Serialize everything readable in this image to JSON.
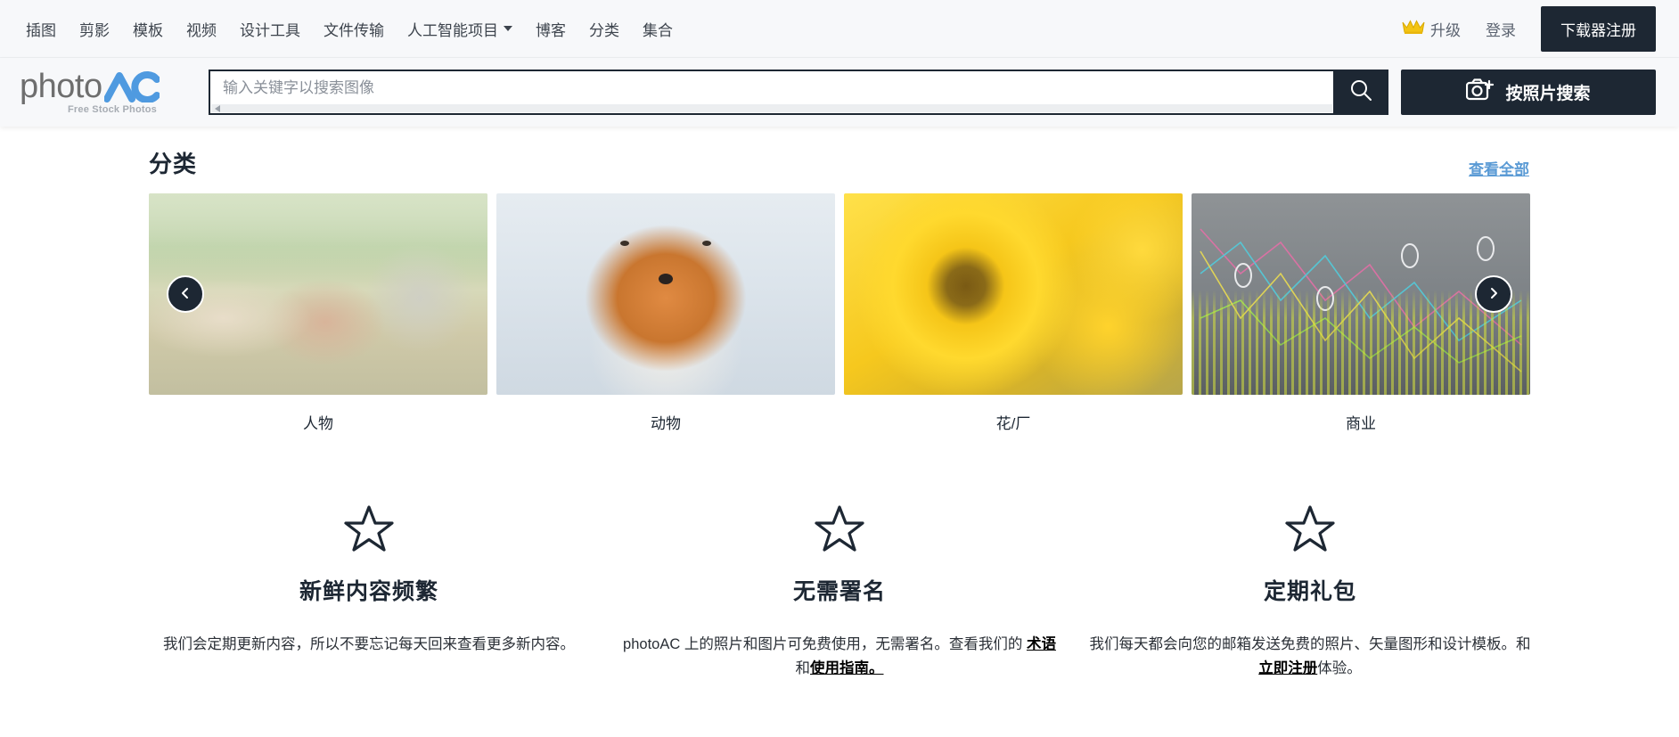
{
  "topnav": {
    "items": [
      {
        "label": "插图",
        "has_caret": false
      },
      {
        "label": "剪影",
        "has_caret": false
      },
      {
        "label": "模板",
        "has_caret": false
      },
      {
        "label": "视频",
        "has_caret": false
      },
      {
        "label": "设计工具",
        "has_caret": false
      },
      {
        "label": "文件传输",
        "has_caret": false
      },
      {
        "label": "人工智能项目",
        "has_caret": true
      },
      {
        "label": "博客",
        "has_caret": false
      },
      {
        "label": "分类",
        "has_caret": false
      },
      {
        "label": "集合",
        "has_caret": false
      }
    ],
    "upgrade_label": "升级",
    "login_label": "登录",
    "register_label": "下载器注册",
    "crown_icon": "crown-icon"
  },
  "search": {
    "logo_text_1": "photo",
    "logo_text_2": "AC",
    "logo_tagline": "Free Stock Photos",
    "placeholder": "输入关键字以搜索图像",
    "value": "",
    "search_icon": "search-icon",
    "photo_search_label": "按照片搜索",
    "camera_icon": "camera-plus-icon"
  },
  "categories": {
    "title": "分类",
    "view_all": "查看全部",
    "prev_icon": "chevron-left-icon",
    "next_icon": "chevron-right-icon",
    "items": [
      {
        "label": "人物",
        "art": "t-people"
      },
      {
        "label": "动物",
        "art": "t-fox"
      },
      {
        "label": "花/厂",
        "art": "t-flower"
      },
      {
        "label": "商业",
        "art": "t-biz"
      }
    ]
  },
  "features": [
    {
      "icon": "star-icon",
      "title": "新鲜内容频繁",
      "desc_prefix": "我们会定期更新内容，所以不要忘记每天回来查看更多新内容。",
      "link1": "",
      "desc_mid": "",
      "link2": "",
      "desc_suffix": ""
    },
    {
      "icon": "star-icon",
      "title": "无需署名",
      "desc_prefix": "photoAC 上的照片和图片可免费使用，无需署名。查看我们的 ",
      "link1": "术语",
      "desc_mid": "和",
      "link2": "使用指南。",
      "desc_suffix": ""
    },
    {
      "icon": "star-icon",
      "title": "定期礼包",
      "desc_prefix": "我们每天都会向您的邮箱发送免费的照片、矢量图形和设计模板。和",
      "link1": "立即注册",
      "desc_mid": "体验。",
      "link2": "",
      "desc_suffix": ""
    }
  ]
}
